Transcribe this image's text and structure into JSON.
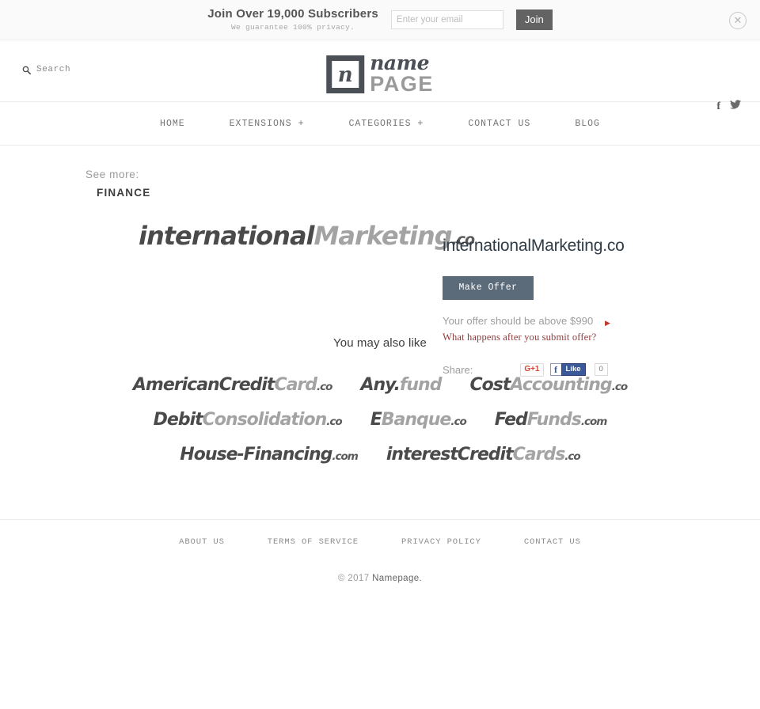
{
  "subscribe_bar": {
    "headline": "Join Over 19,000 Subscribers",
    "subtext": "We guarantee 100% privacy.",
    "email_placeholder": "Enter your email",
    "email_value": "",
    "join_label": "Join",
    "close_icon": "close-circle-icon"
  },
  "header": {
    "search_label": "Search",
    "search_icon": "search-icon",
    "logo": {
      "mark_glyph": "n",
      "name_text": "name",
      "page_text": "PAGE"
    },
    "social": [
      {
        "name": "facebook-icon",
        "glyph": "f"
      },
      {
        "name": "twitter-icon",
        "glyph": "twitter-bird"
      }
    ]
  },
  "nav": {
    "items": [
      {
        "label": "HOME"
      },
      {
        "label": "EXTENSIONS +"
      },
      {
        "label": "CATEGORIES +"
      },
      {
        "label": "CONTACT US"
      },
      {
        "label": "BLOG"
      }
    ]
  },
  "main": {
    "see_more_label": "See more:",
    "category": "FINANCE",
    "hero_domain": {
      "part1": "international",
      "part2": "Marketing",
      "tld": ".co"
    },
    "offer": {
      "domain_title": "internationalMarketing.co",
      "make_offer_label": "Make Offer",
      "hint_text": "Your offer should be above $990",
      "minimum_price": "$990",
      "arrow_icon": "right-arrow-icon",
      "help_link": "What happens after you submit offer?",
      "share_label": "Share:",
      "gplus_label": "G+1",
      "fb_like_f": "f",
      "fb_like_label": "Like",
      "fb_count": "0"
    }
  },
  "also_like": {
    "title": "You may also like",
    "rows": [
      [
        {
          "part1": "AmericanCredit",
          "part2": "Card",
          "tld": ".co"
        },
        {
          "part1": "Any.",
          "part2": "fund",
          "tld": ""
        },
        {
          "part1": "Cost",
          "part2": "Accounting",
          "tld": ".co"
        }
      ],
      [
        {
          "part1": "Debit",
          "part2": "Consolidation",
          "tld": ".co"
        },
        {
          "part1": "E",
          "part2": "Banque",
          "tld": ".co"
        },
        {
          "part1": "Fed",
          "part2": "Funds",
          "tld": ".com"
        }
      ],
      [
        {
          "part1": "House-Financing",
          "part2": "",
          "tld": ".com"
        },
        {
          "part1": "interestCredit",
          "part2": "Cards",
          "tld": ".co"
        }
      ]
    ]
  },
  "footer": {
    "links": [
      {
        "label": "ABOUT US"
      },
      {
        "label": "TERMS OF SERVICE"
      },
      {
        "label": "PRIVACY POLICY"
      },
      {
        "label": "CONTACT US"
      }
    ],
    "copyright_prefix": "© 2017 ",
    "copyright_brand": "Namepage."
  },
  "colors": {
    "accent_button": "#5c6b7a",
    "join_button": "#636363",
    "logo_mark": "#4b5057",
    "domain_dark": "#4a4a4a",
    "domain_light": "#a3a3a3",
    "link_red": "#8e3b3b",
    "arrow_red": "#c0392b",
    "facebook_blue": "#3b5998",
    "gplus_red": "#d14836"
  }
}
